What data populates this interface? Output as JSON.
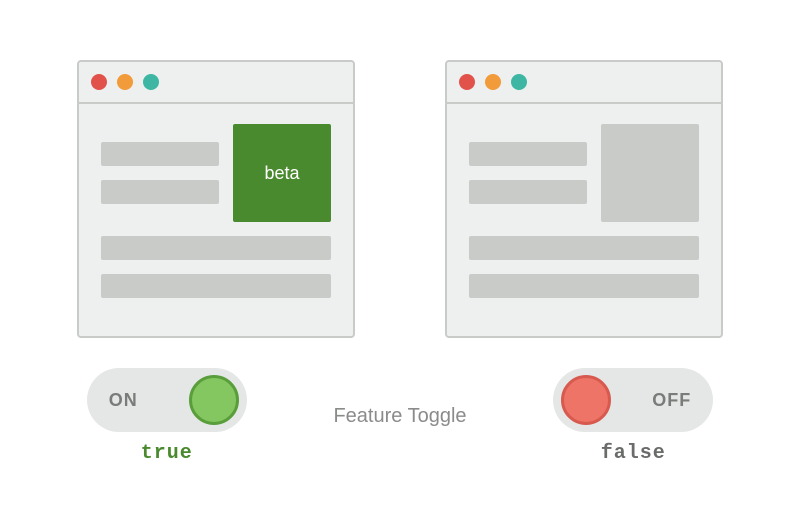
{
  "title": "Feature Toggle",
  "left": {
    "feature_label": "beta",
    "toggle_label": "ON",
    "value_label": "true"
  },
  "right": {
    "toggle_label": "OFF",
    "value_label": "false"
  },
  "colors": {
    "dot_red": "#e1534a",
    "dot_orange": "#f29b3a",
    "dot_teal": "#3db7a3",
    "feature_on": "#4a8a2e",
    "knob_on": "#84c660",
    "knob_off": "#ef7468"
  }
}
